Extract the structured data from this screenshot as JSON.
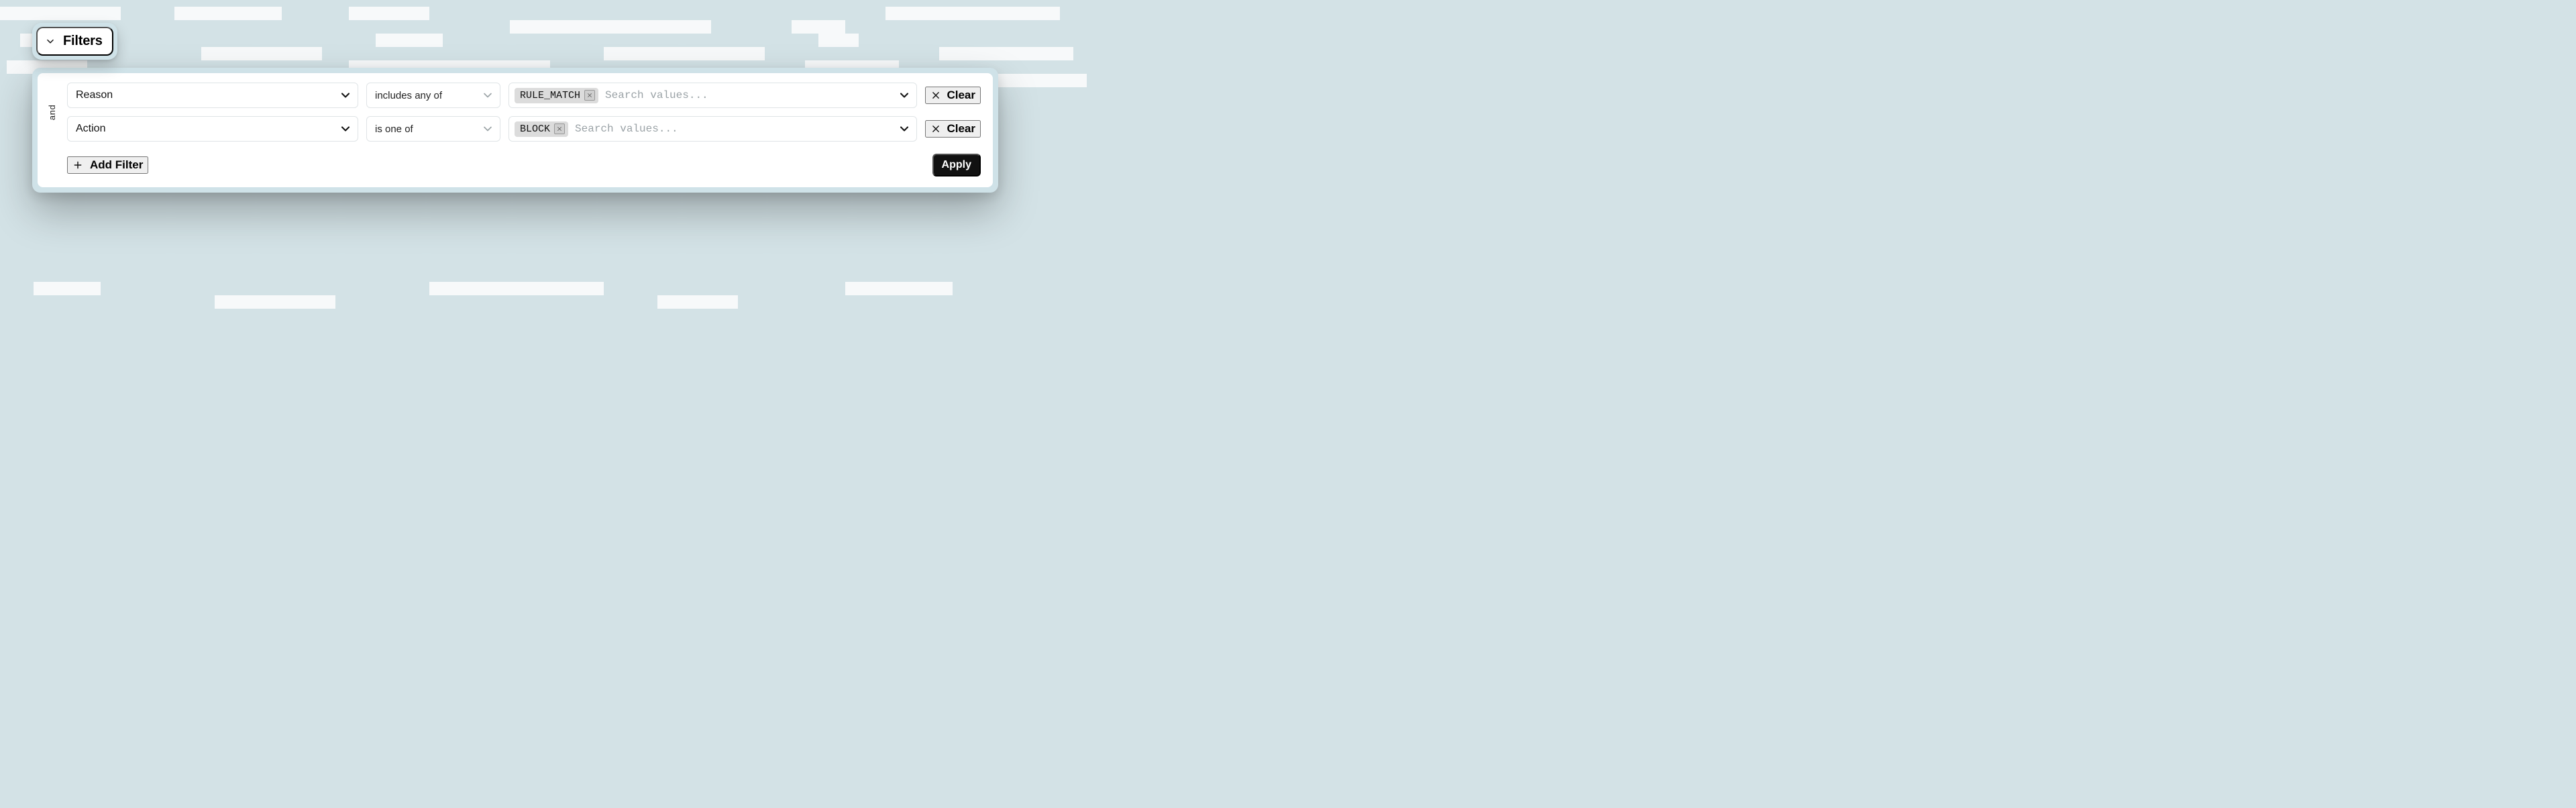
{
  "header": {
    "toggle_label": "Filters"
  },
  "filters": {
    "connective": "and",
    "rows": [
      {
        "field": "Reason",
        "operator": "includes any of",
        "chips": [
          "RULE_MATCH"
        ],
        "search_placeholder": "Search values...",
        "clear_label": "Clear"
      },
      {
        "field": "Action",
        "operator": "is one of",
        "chips": [
          "BLOCK"
        ],
        "search_placeholder": "Search values...",
        "clear_label": "Clear"
      }
    ],
    "add_filter_label": "Add Filter",
    "apply_label": "Apply"
  }
}
